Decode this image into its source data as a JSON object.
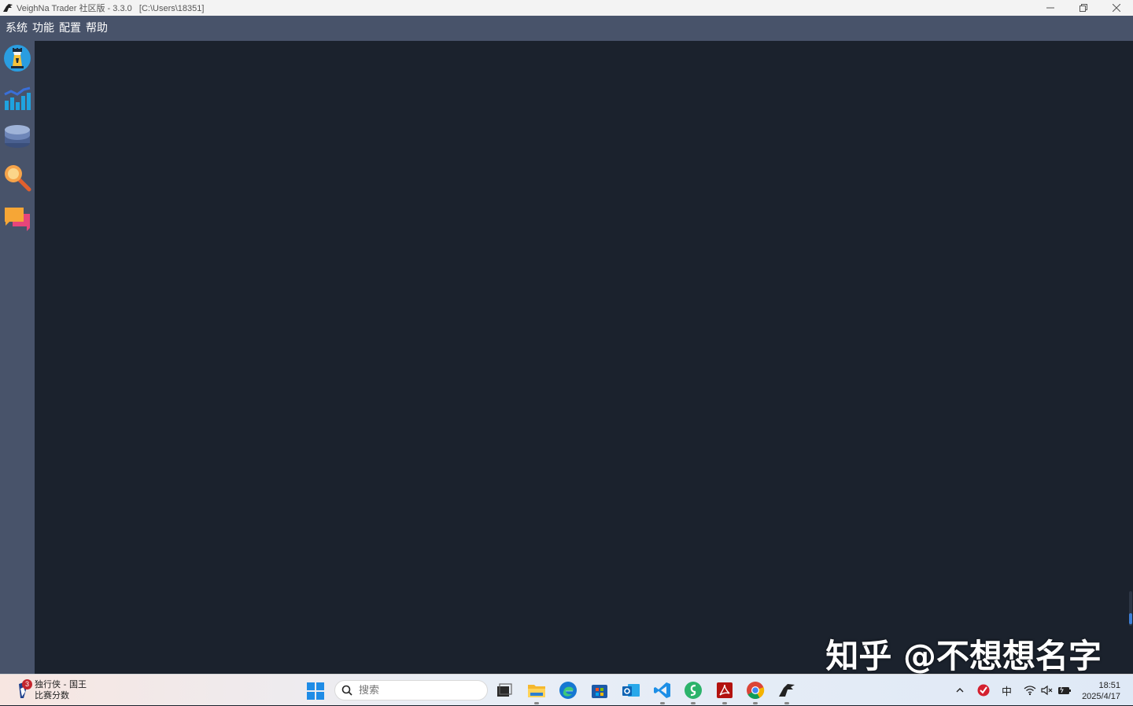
{
  "window": {
    "title": "VeighNa Trader 社区版 - 3.3.0   [C:\\Users\\18351]"
  },
  "menubar": {
    "items": [
      {
        "label": "系统"
      },
      {
        "label": "功能"
      },
      {
        "label": "配置"
      },
      {
        "label": "帮助"
      }
    ]
  },
  "toolbar": {
    "tools": [
      {
        "icon": "chess-rook-icon"
      },
      {
        "icon": "bar-chart-icon"
      },
      {
        "icon": "database-icon"
      },
      {
        "icon": "magnifier-icon"
      },
      {
        "icon": "chat-bubbles-icon"
      }
    ]
  },
  "watermark": {
    "text": "知乎 @不想想名字"
  },
  "taskbar": {
    "widget": {
      "badge": "3",
      "line1": "独行侠 - 国王",
      "line2": "比赛分数"
    },
    "search": {
      "placeholder": "搜索"
    },
    "tray": {
      "ime": "中"
    },
    "clock": {
      "time": "18:51",
      "date": "2025/4/17"
    }
  },
  "colors": {
    "menubar": "#48536a",
    "main_bg": "#1b222d",
    "titlebar": "#f3f3f3"
  }
}
